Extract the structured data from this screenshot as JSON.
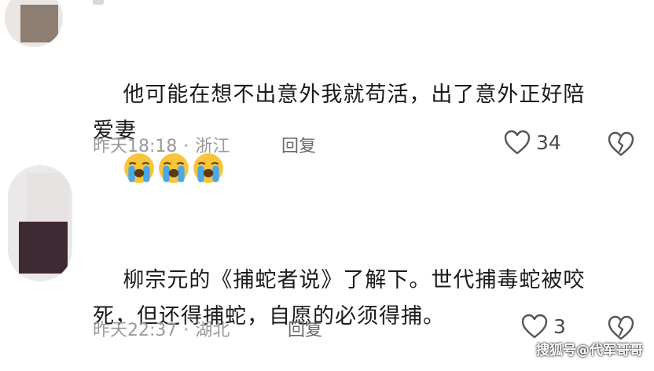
{
  "comments": [
    {
      "text_line1": "他可能在想不出意外我就苟活，出了意外正好陪",
      "text_line2": "爱妻",
      "time": "昨天18:18",
      "location": "浙江",
      "reply_label": "回复",
      "likes": "34",
      "emoji_count": 3,
      "emoji_icon": "loudly-crying-face-icon"
    },
    {
      "text_line1": "柳宗元的《捕蛇者说》了解下。世代捕毒蛇被咬",
      "text_line2": "死，但还得捕蛇，自愿的必须得捕。",
      "time": "昨天22:37",
      "location": "湖北",
      "reply_label": "回复",
      "likes": "3"
    }
  ],
  "separator": "·",
  "watermark": "搜狐号@代军哥哥",
  "colors": {
    "meta": "#9a9a9a",
    "text": "#1b1b1b",
    "emoji_yellow": "#f7c43a",
    "emoji_tear": "#4aa8e8"
  }
}
